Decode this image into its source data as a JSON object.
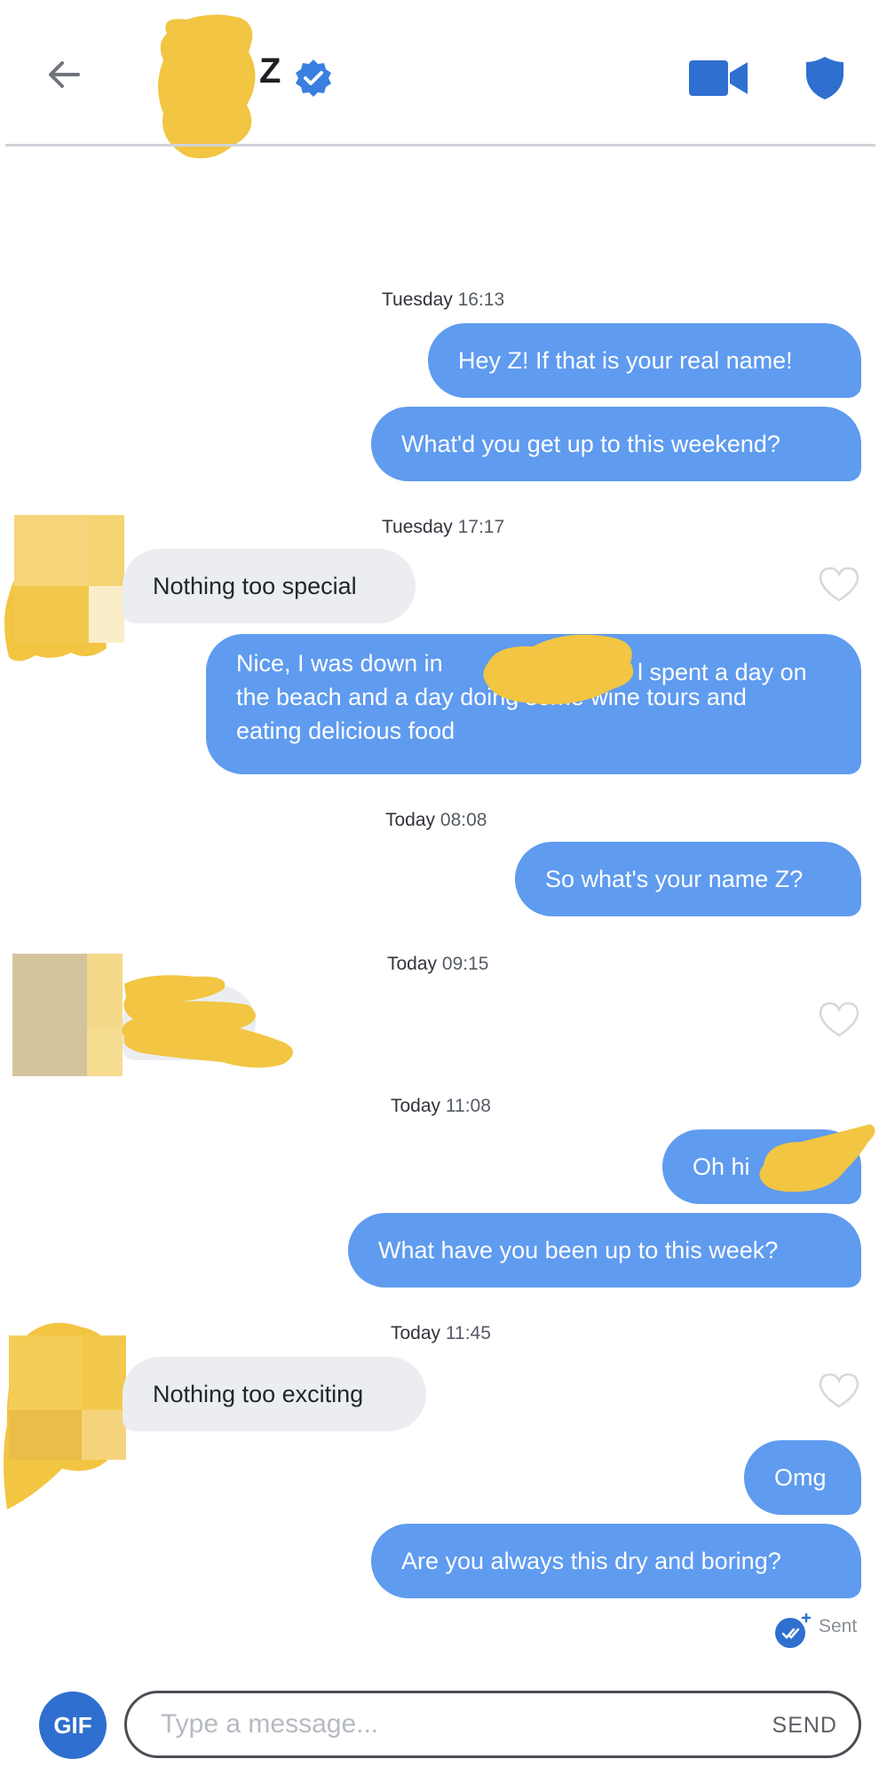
{
  "header": {
    "back_icon": "arrow-left-icon",
    "contact_name": "Z",
    "verified_icon": "verified-check-icon",
    "video_icon": "video-camera-icon",
    "safety_icon": "shield-icon"
  },
  "messages": {
    "t1": {
      "day": "Tuesday",
      "time": "16:13"
    },
    "m1": "Hey Z! If that is your real name!",
    "m2": "What'd you get up to this weekend?",
    "t2": {
      "day": "Tuesday",
      "time": "17:17"
    },
    "m3": "Nothing too special",
    "m4": "Nice, I was down in \nthe beach and a day doing some wine tours and\neating delicious food",
    "m4_tail": "l spent a day on",
    "t3": {
      "day": "Today",
      "time": "08:08"
    },
    "m5": "So what's your name Z?",
    "t4": {
      "day": "Today",
      "time": "09:15"
    },
    "t5": {
      "day": "Today",
      "time": "11:08"
    },
    "m6": "Oh hi",
    "m7": "What have you been up to this week?",
    "t6": {
      "day": "Today",
      "time": "11:45"
    },
    "m8": "Nothing too exciting",
    "m9": "Omg",
    "m10": "Are you always this dry and boring?",
    "status": "Sent"
  },
  "composer": {
    "gif_label": "GIF",
    "placeholder": "Type a message...",
    "send_label": "SEND"
  },
  "colors": {
    "outgoing_bubble": "#5f9bef",
    "incoming_bubble": "#ebedf1",
    "accent": "#2f6fcf",
    "redaction": "#f2c542"
  }
}
